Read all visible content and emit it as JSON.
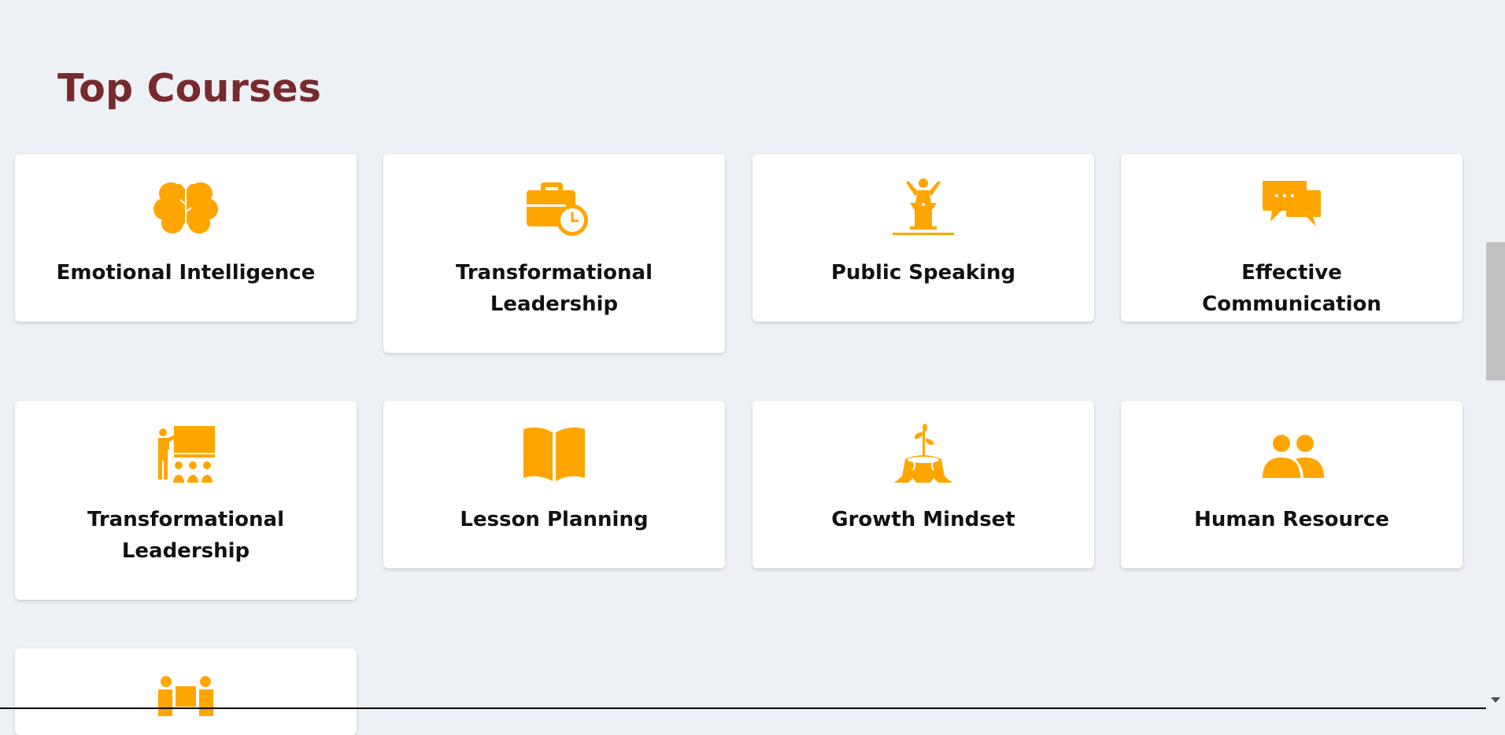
{
  "section": {
    "title": "Top Courses"
  },
  "colors": {
    "background": "#edf1f5",
    "title": "#772a2c",
    "icon": "#ffa500",
    "card": "#ffffff"
  },
  "courses": [
    {
      "label": "Emotional Intelligence",
      "icon": "brain-icon"
    },
    {
      "label": "Transformational Leadership",
      "icon": "briefcase-clock-icon"
    },
    {
      "label": "Public Speaking",
      "icon": "podium-speaker-icon"
    },
    {
      "label": "Effective Communication",
      "icon": "chat-bubbles-icon"
    },
    {
      "label": "Transformational Leadership",
      "icon": "teacher-presentation-icon"
    },
    {
      "label": "Lesson Planning",
      "icon": "open-book-icon"
    },
    {
      "label": "Growth Mindset",
      "icon": "stump-sprout-icon"
    },
    {
      "label": "Human Resource",
      "icon": "people-group-icon"
    },
    {
      "label": "",
      "icon": "team-people-icon"
    }
  ]
}
